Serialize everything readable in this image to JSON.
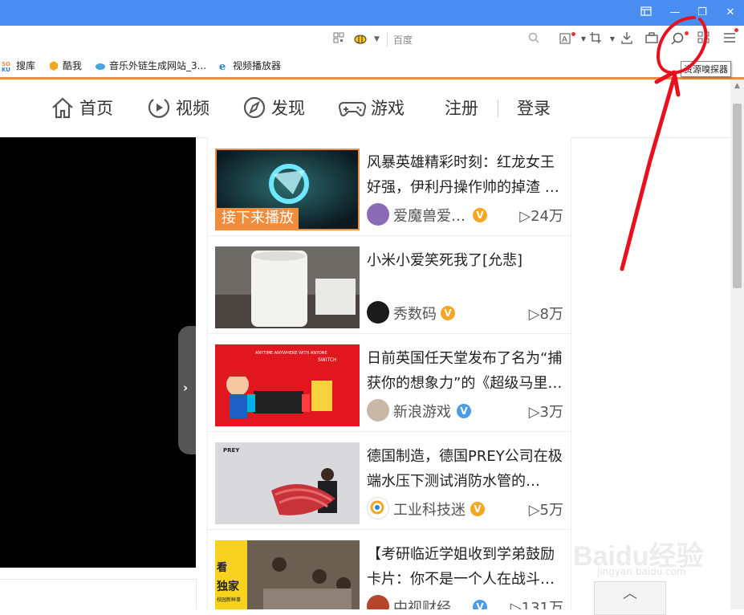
{
  "window": {
    "controls": {
      "restore_icon": "restore-icon",
      "minimize": "—",
      "maximize": "❐",
      "close": "✕"
    }
  },
  "addressbar": {
    "search_engine": "百度"
  },
  "tooltip": "资源嗅探器",
  "bookmarks": [
    {
      "label": "搜库",
      "icon": "soku-icon"
    },
    {
      "label": "酷我",
      "icon": "kuwo-icon"
    },
    {
      "label": "音乐外链生成网站_3...",
      "icon": "music-link-icon"
    },
    {
      "label": "视频播放器",
      "icon": "ie-icon"
    }
  ],
  "nav": {
    "home": "首页",
    "video": "视频",
    "discover": "发现",
    "game": "游戏",
    "register": "注册",
    "login": "登录"
  },
  "player": {
    "next_arrow": "›"
  },
  "feed": [
    {
      "title": "风暴英雄精彩时刻：红龙女王好强，伊利丹操作帅的掉渣 …",
      "author": "爱魔兽爱…",
      "badge": "V",
      "badge_color": "#f5a623",
      "plays": "▷24万",
      "next_label": "接下来播放"
    },
    {
      "title": "小米小爱笑死我了[允悲]",
      "author": "秀数码",
      "badge": "V",
      "badge_color": "#f5a623",
      "plays": "▷8万"
    },
    {
      "title": "日前英国任天堂发布了名为“捕获你的想象力”的《超级马里…",
      "author": "新浪游戏",
      "badge": "V",
      "badge_color": "#4a9be8",
      "plays": "▷3万"
    },
    {
      "title": "德国制造，德国PREY公司在极端水压下测试消防水管的…",
      "author": "工业科技迷",
      "badge": "V",
      "badge_color": "#f5a623",
      "plays": "▷5万"
    },
    {
      "title": "【考研临近学姐收到学弟鼓励卡片：你不是一个人在战斗…",
      "author": "中视财经",
      "badge": "V",
      "badge_color": "#4a9be8",
      "plays": "▷131万"
    }
  ],
  "thumb_text": {
    "card3_banner": "ANYTIME ANYWHERE WITH ANYONE",
    "card3_brand": "SWITCH",
    "card4_logo": "PREY",
    "card5_side1": "看",
    "card5_side2": "独家",
    "card5_side3": "校园新鲜事"
  },
  "backtop": "︿",
  "watermark": {
    "text": "Baidu经验",
    "sub": "jingyan.baidu.com"
  },
  "colors": {
    "titlebar": "#4a8df0",
    "accent": "#f08c3c",
    "annotation": "#e8101e"
  }
}
